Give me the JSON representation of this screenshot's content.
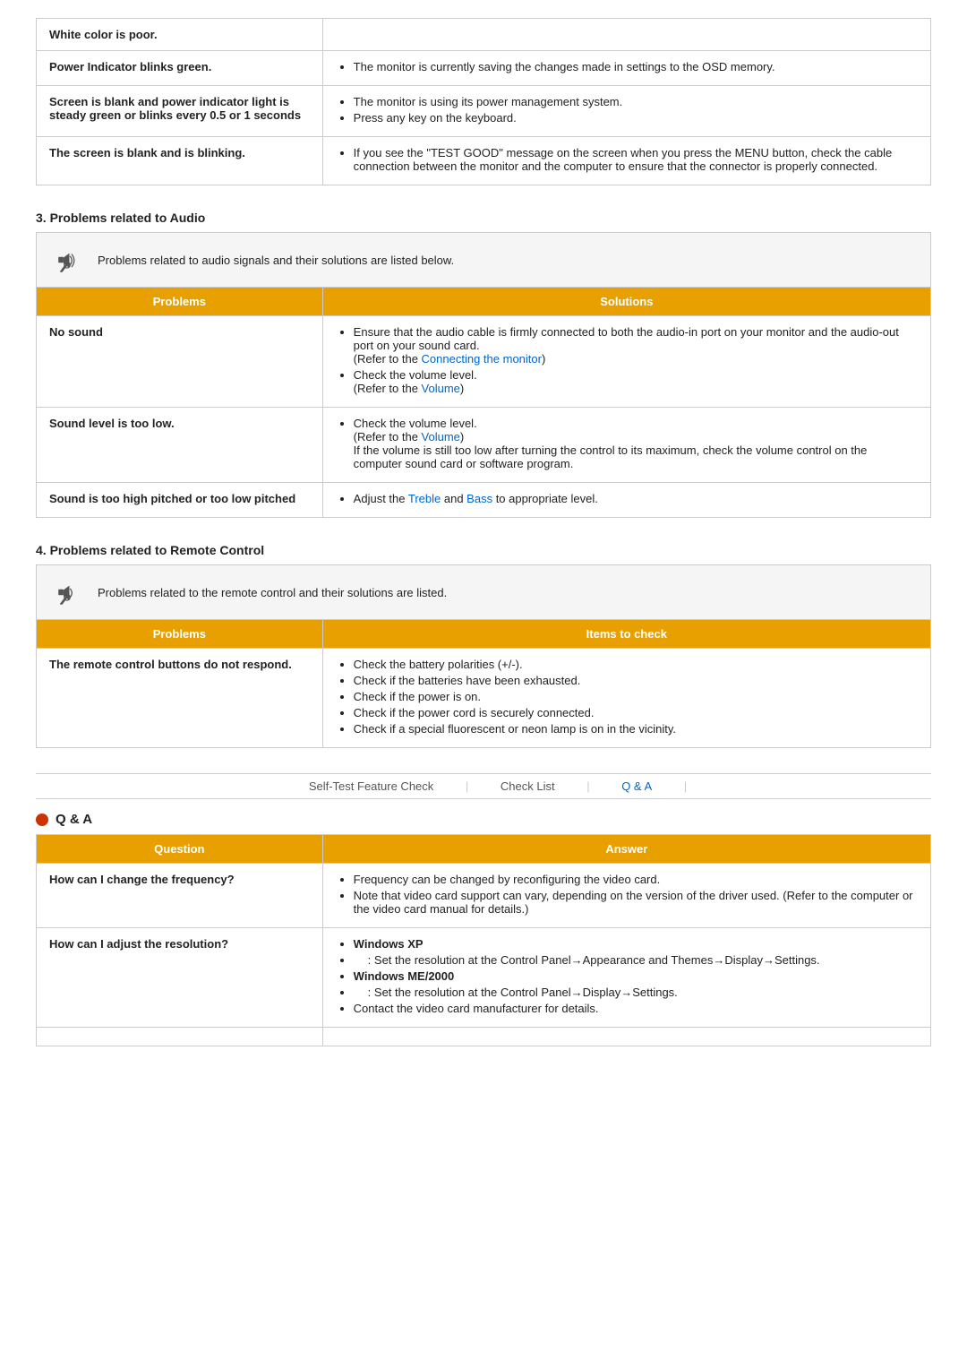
{
  "top_table": {
    "rows": [
      {
        "problem": "White color is poor.",
        "solutions": []
      },
      {
        "problem": "Power Indicator blinks green.",
        "solutions": [
          "The monitor is currently saving the changes made in settings to the OSD memory."
        ]
      },
      {
        "problem": "Screen is blank and power indicator light is steady green or blinks every 0.5 or 1 seconds",
        "solutions": [
          "The monitor is using its power management system.",
          "Press any key on the keyboard."
        ]
      },
      {
        "problem": "The screen is blank and is blinking.",
        "solutions": [
          "If you see the \"TEST GOOD\" message on the screen when you press the MENU button, check the cable connection between the monitor and the computer to ensure that the connector is properly connected."
        ]
      }
    ]
  },
  "audio_section": {
    "heading": "3. Problems related to Audio",
    "icon_label": "audio-icon",
    "description": "Problems related to audio signals and their solutions are listed below.",
    "col_problems": "Problems",
    "col_solutions": "Solutions",
    "rows": [
      {
        "problem": "No sound",
        "solutions_html": "Ensure that the audio cable is firmly connected to both the audio-in port on your monitor and the audio-out port on your sound card.<br>(Refer to the <a href='#'>Connecting the monitor</a>)<br>Check the volume level.<br>(Refer to the <a href='#'>Volume</a>)"
      },
      {
        "problem": "Sound level is too low.",
        "solutions_html": "Check the volume level.<br>(Refer to the <a href='#'>Volume</a>)<br>If the volume is still too low after turning the control to its maximum, check the volume control on the computer sound card or software program."
      },
      {
        "problem": "Sound is too high pitched or too low pitched",
        "solutions_html": "Adjust the <a href='#'>Treble</a> and <a href='#'>Bass</a> to appropriate level."
      }
    ]
  },
  "remote_section": {
    "heading": "4. Problems related to Remote Control",
    "icon_label": "remote-icon",
    "description": "Problems related to the remote control and their solutions are listed.",
    "col_problems": "Problems",
    "col_check": "Items to check",
    "rows": [
      {
        "problem": "The remote control buttons do not respond.",
        "items_html": "Check the battery polarities (+/-).<br>Check if the batteries have been exhausted.<br>Check if the power is on.<br>Check if the power cord is securely connected.<br>Check if a special fluorescent or neon lamp is on in the vicinity."
      }
    ]
  },
  "navbar": {
    "items": [
      {
        "label": "Self-Test Feature Check",
        "active": false
      },
      {
        "label": "Check List",
        "active": false
      },
      {
        "label": "Q & A",
        "active": true
      }
    ]
  },
  "qa_section": {
    "title": "Q & A",
    "col_question": "Question",
    "col_answer": "Answer",
    "rows": [
      {
        "question": "How can I change the frequency?",
        "answer_html": "Frequency can be changed by reconfiguring the video card.<br>Note that video card support can vary, depending on the version of the driver used. (Refer to the computer or the video card manual for details.)"
      },
      {
        "question": "How can I adjust the resolution?",
        "answer_html": "<strong>Windows XP</strong><br><span class='indent'>: Set the resolution at the Control Panel→Appearance and Themes→Display→Settings.</span><br><strong>Windows ME/2000</strong><br><span class='indent'>: Set the resolution at the Control Panel→Display→Settings.</span><br>Contact the video card manufacturer for details."
      },
      {
        "question": "",
        "answer_html": ""
      }
    ]
  }
}
